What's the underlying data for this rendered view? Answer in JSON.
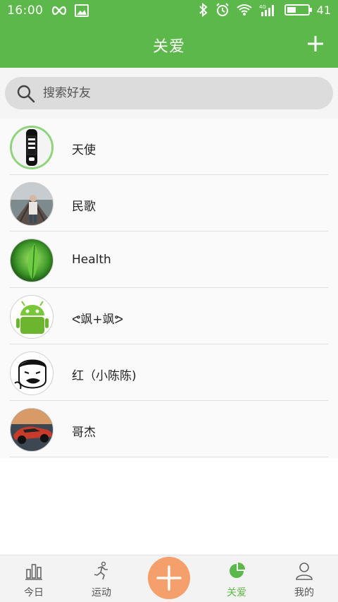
{
  "status_bar": {
    "time": "16:00",
    "battery": "41"
  },
  "app_bar": {
    "title": "关爱"
  },
  "search": {
    "placeholder": "搜索好友"
  },
  "friends": [
    {
      "name": "天使",
      "avatar": "watch-avatar"
    },
    {
      "name": "民歌",
      "avatar": "person-photo-avatar"
    },
    {
      "name": "Health",
      "avatar": "leaf-avatar"
    },
    {
      "name": "ᕙ飒+飒ᕗ",
      "avatar": "android-avatar"
    },
    {
      "name": "红（小陈陈)",
      "avatar": "meme-avatar"
    },
    {
      "name": "哥杰",
      "avatar": "car-avatar"
    }
  ],
  "bottom_nav": {
    "items": [
      {
        "label": "今日",
        "icon": "bar-chart-icon"
      },
      {
        "label": "运动",
        "icon": "runner-icon"
      },
      {
        "label": "关爱",
        "icon": "pie-chart-icon",
        "active": true
      },
      {
        "label": "我的",
        "icon": "user-icon"
      }
    ]
  },
  "colors": {
    "primary": "#5cb84a",
    "accent": "#f59f6b"
  }
}
